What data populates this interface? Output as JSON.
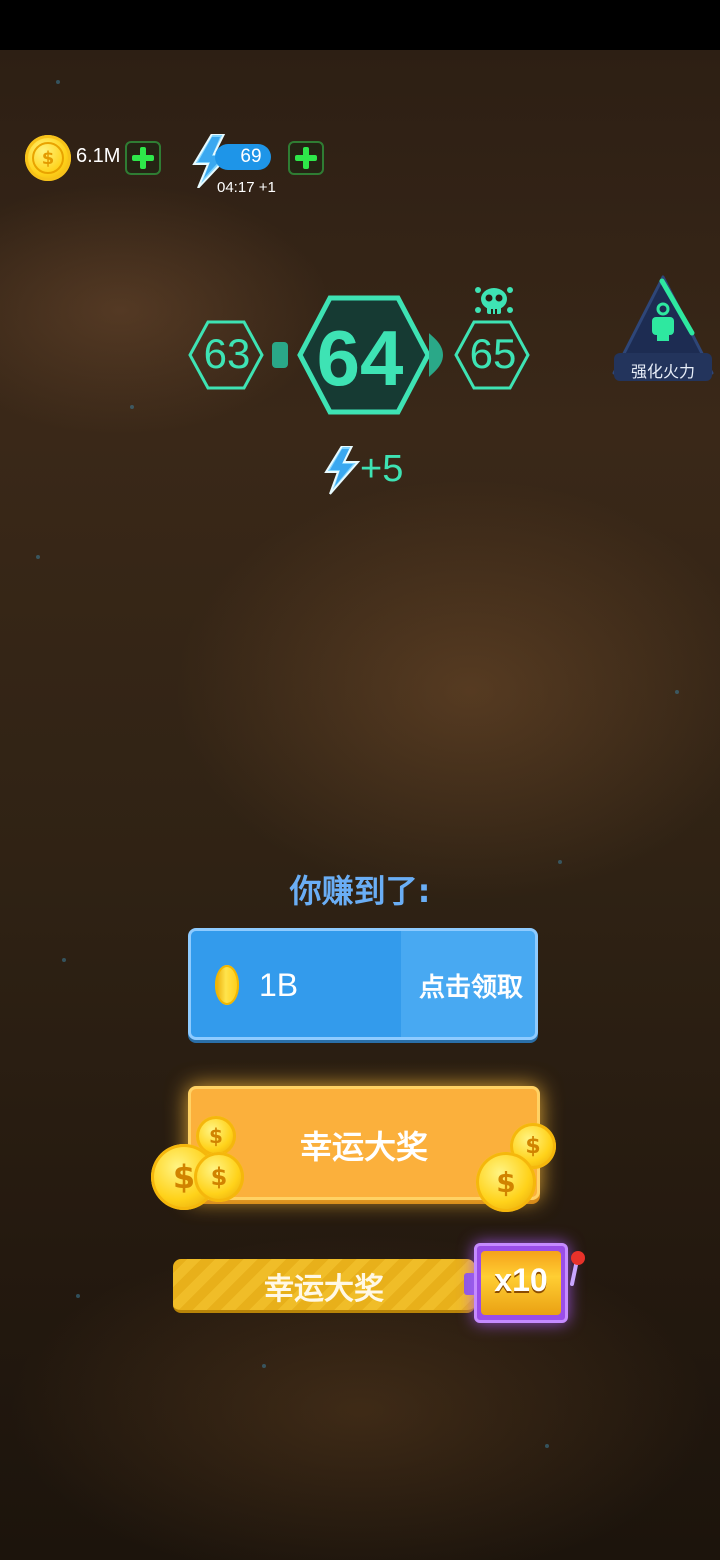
{
  "hud": {
    "coins": "6.1M",
    "energy": "69",
    "energy_timer": "04:17 +1"
  },
  "level": {
    "previous": "63",
    "current": "64",
    "next": "65",
    "energy_reward": "+5"
  },
  "side_badge": {
    "label": "强化火力"
  },
  "earned": {
    "title": "你赚到了:",
    "amount": "1B",
    "claim_label": "点击领取"
  },
  "lucky": {
    "main_label": "幸运大奖",
    "bar_label": "幸运大奖",
    "multiplier": "x10"
  },
  "colors": {
    "accent_teal": "#3ee3b4",
    "claim_blue": "#339bec",
    "lucky_orange": "#fbb03c",
    "slot_purple": "#9a4de8",
    "plus_green": "#2ee84a"
  },
  "icons": [
    "coin-icon",
    "plus-icon",
    "lightning-icon",
    "skull-icon",
    "rocket-icon",
    "slot-machine-icon"
  ]
}
